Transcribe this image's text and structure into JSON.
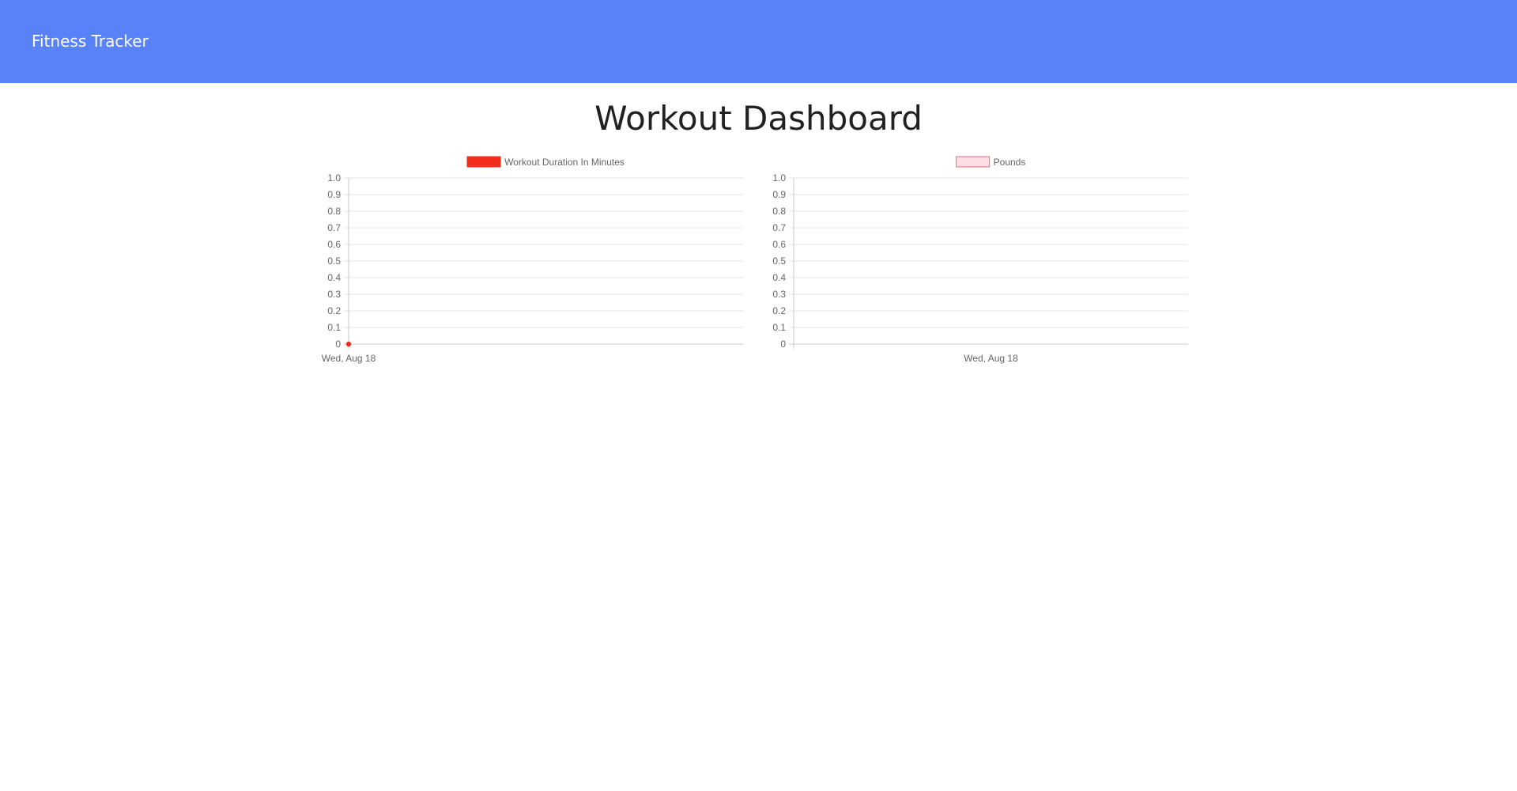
{
  "navbar": {
    "brand": "Fitness Tracker",
    "background": "#5a82f8"
  },
  "page_title": "Workout Dashboard",
  "chart_data": [
    {
      "type": "line",
      "legend_position": "top",
      "grid": true,
      "categories": [
        "Wed, Aug 18"
      ],
      "ylim": [
        0,
        1
      ],
      "y_ticks": [
        "0",
        "0.1",
        "0.2",
        "0.3",
        "0.4",
        "0.5",
        "0.6",
        "0.7",
        "0.8",
        "0.9",
        "1.0"
      ],
      "series": [
        {
          "name": "Workout Duration In Minutes",
          "values": [
            0
          ],
          "color": "#f22f1c",
          "legend_fill": "#f22f1c",
          "legend_border": "#f22f1c",
          "show_points": true
        }
      ]
    },
    {
      "type": "bar",
      "legend_position": "top",
      "grid": true,
      "categories": [
        "Wed, Aug 18"
      ],
      "ylim": [
        0,
        1
      ],
      "y_ticks": [
        "0",
        "0.1",
        "0.2",
        "0.3",
        "0.4",
        "0.5",
        "0.6",
        "0.7",
        "0.8",
        "0.9",
        "1.0"
      ],
      "series": [
        {
          "name": "Pounds",
          "values": [
            0
          ],
          "color": "#ffdde4",
          "legend_fill": "#ffdde4",
          "legend_border": "#ee6b7e",
          "show_points": false
        }
      ]
    }
  ]
}
